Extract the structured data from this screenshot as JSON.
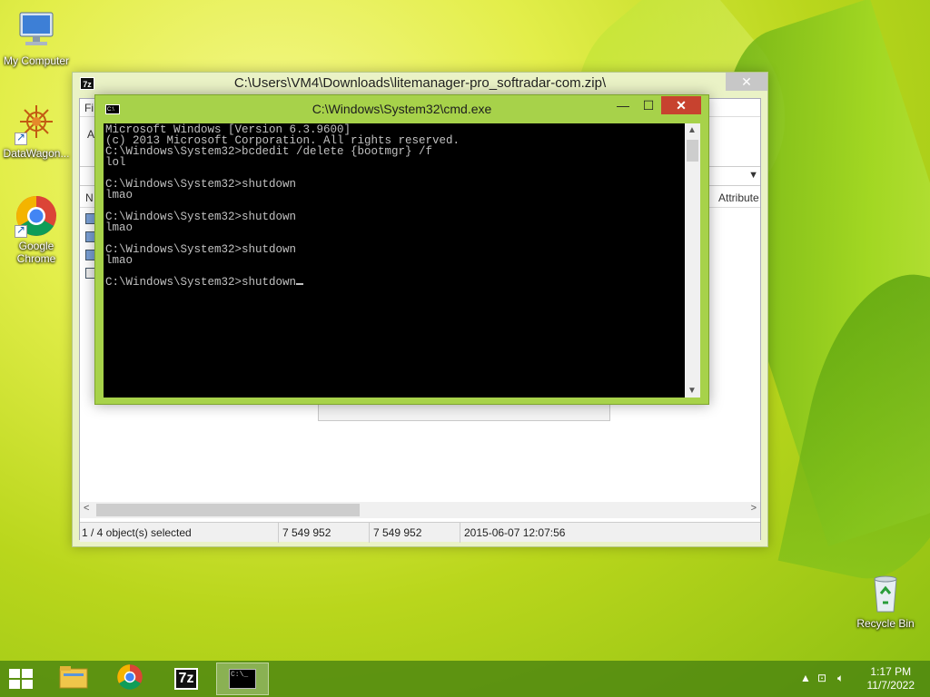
{
  "desktop": {
    "icons": [
      {
        "label": "My Computer",
        "icon": "computer-icon"
      },
      {
        "label": "DataWagon...",
        "icon": "datawagon-icon"
      },
      {
        "label": "Google Chrome",
        "icon": "chrome-icon"
      },
      {
        "label": "Recycle Bin",
        "icon": "recycle-bin-icon"
      }
    ]
  },
  "zip_window": {
    "title": "C:\\Users\\VM4\\Downloads\\litemanager-pro_softradar-com.zip\\",
    "app_icon_text": "7z",
    "menubar_partial": "Fi",
    "toolbar_partial": "A",
    "column_name_partial": "N",
    "column_attributes": "Attribute",
    "status": {
      "selected": "1 / 4 object(s) selected",
      "size": "7 549 952",
      "packed_size": "7 549 952",
      "modified": "2015-06-07 12:07:56"
    }
  },
  "cmd_window": {
    "title": "C:\\Windows\\System32\\cmd.exe",
    "lines": [
      "Microsoft Windows [Version 6.3.9600]",
      "(c) 2013 Microsoft Corporation. All rights reserved.",
      "C:\\Windows\\System32>bcdedit /delete {bootmgr} /f",
      "lol",
      "",
      "C:\\Windows\\System32>shutdown",
      "lmao",
      "",
      "C:\\Windows\\System32>shutdown",
      "lmao",
      "",
      "C:\\Windows\\System32>shutdown",
      "lmao",
      "",
      "C:\\Windows\\System32>shutdown"
    ]
  },
  "taskbar": {
    "items": [
      {
        "name": "file-explorer",
        "icon": "folder-icon"
      },
      {
        "name": "google-chrome",
        "icon": "chrome-icon"
      },
      {
        "name": "7-zip",
        "icon": "7zip-icon",
        "text": "7z"
      },
      {
        "name": "command-prompt",
        "icon": "cmd-icon",
        "text": "C:\\_",
        "active": true
      }
    ],
    "clock": {
      "time": "1:17 PM",
      "date": "11/7/2022"
    }
  }
}
